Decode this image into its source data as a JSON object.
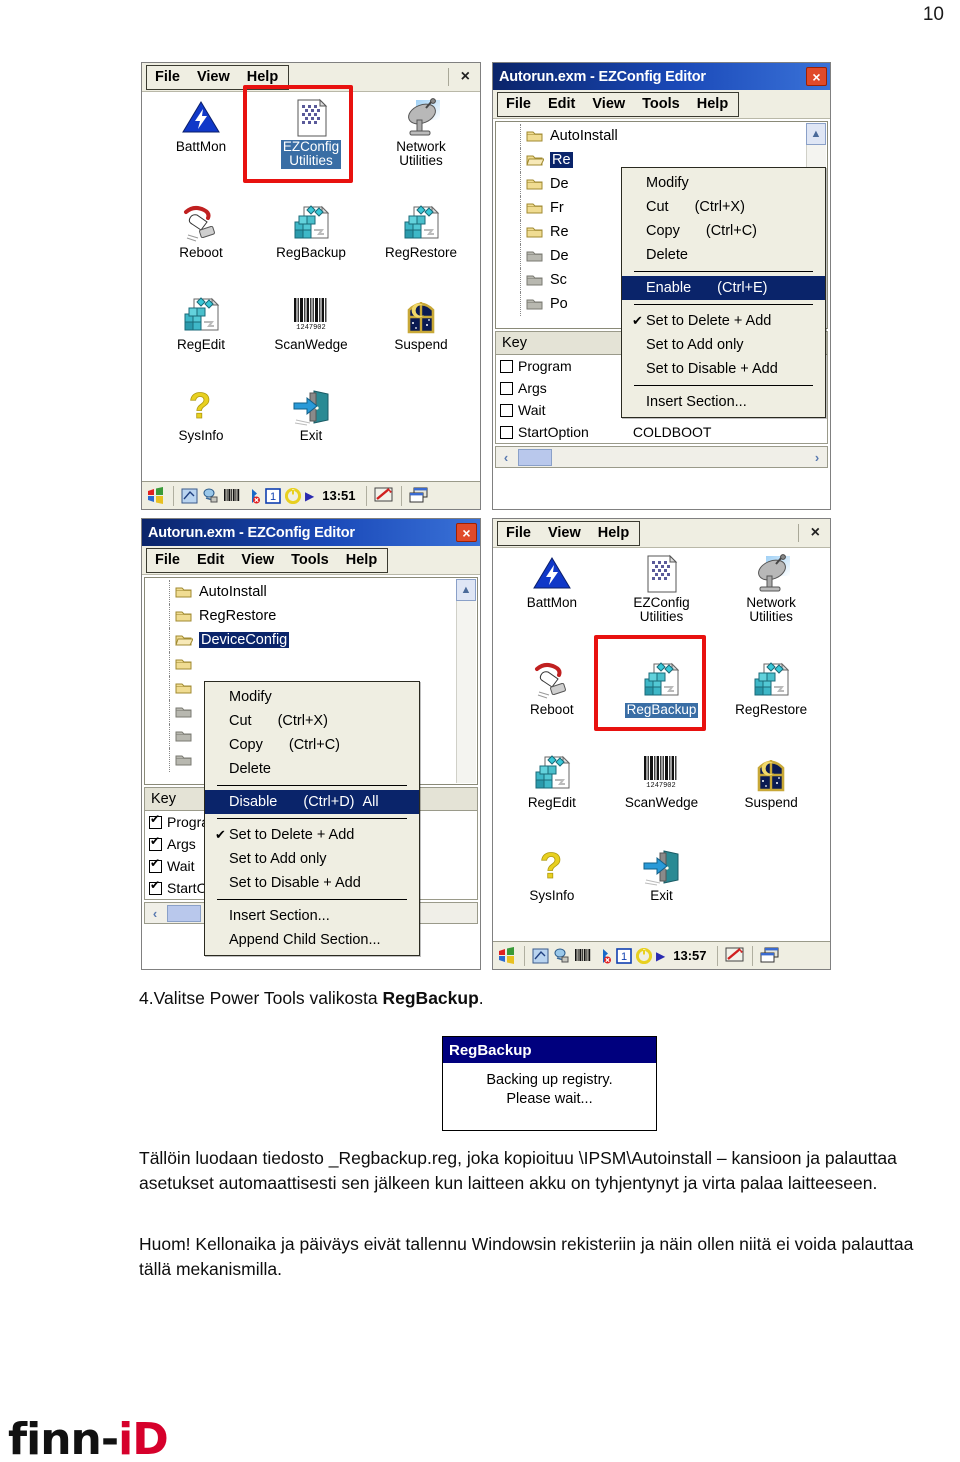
{
  "page": {
    "number": "10"
  },
  "footer": {
    "logo_black": "finn-",
    "logo_red": "iD"
  },
  "panel_top_left": {
    "menu": {
      "file": "File",
      "view": "View",
      "help": "Help",
      "close_icon": "×"
    },
    "icons": [
      {
        "name": "BattMon",
        "label": "BattMon",
        "icon": "battery-monitor-icon",
        "selected": false
      },
      {
        "name": "EZConfig",
        "label": "EZConfig\nUtilities",
        "icon": "ezconfig-utilities-icon",
        "selected": true
      },
      {
        "name": "Network",
        "label": "Network\nUtilities",
        "icon": "network-utilities-icon",
        "selected": false
      },
      {
        "name": "Reboot",
        "label": "Reboot",
        "icon": "reboot-icon",
        "selected": false
      },
      {
        "name": "RegBackup",
        "label": "RegBackup",
        "icon": "registry-backup-icon",
        "selected": false
      },
      {
        "name": "RegRestore",
        "label": "RegRestore",
        "icon": "registry-restore-icon",
        "selected": false
      },
      {
        "name": "RegEdit",
        "label": "RegEdit",
        "icon": "registry-edit-icon",
        "selected": false
      },
      {
        "name": "ScanWedge",
        "label": "ScanWedge",
        "icon": "barcode-scanwedge-icon",
        "selected": false
      },
      {
        "name": "Suspend",
        "label": "Suspend",
        "icon": "suspend-moon-icon",
        "selected": false
      },
      {
        "name": "SysInfo",
        "label": "SysInfo",
        "icon": "system-info-question-icon",
        "selected": false
      },
      {
        "name": "Exit",
        "label": "Exit",
        "icon": "exit-door-icon",
        "selected": false
      }
    ],
    "taskbar": {
      "time": "13:51"
    }
  },
  "panel_top_right": {
    "title": "Autorun.exm - EZConfig Editor",
    "close_icon": "×",
    "menu": [
      "File",
      "Edit",
      "View",
      "Tools",
      "Help"
    ],
    "tree": [
      {
        "label": "AutoInstall",
        "selected": false,
        "open": false,
        "grey": false
      },
      {
        "label": "Re",
        "selected": true,
        "open": true,
        "grey": false
      },
      {
        "label": "De",
        "selected": false,
        "open": false,
        "grey": false
      },
      {
        "label": "Fr",
        "selected": false,
        "open": false,
        "grey": false
      },
      {
        "label": "Re",
        "selected": false,
        "open": false,
        "grey": false
      },
      {
        "label": "De",
        "selected": false,
        "open": false,
        "grey": true
      },
      {
        "label": "Sc",
        "selected": false,
        "open": false,
        "grey": true
      },
      {
        "label": "Po",
        "selected": false,
        "open": false,
        "grey": true
      }
    ],
    "key_header": "Key",
    "keys": [
      {
        "label": "Program",
        "checked": false,
        "value": ""
      },
      {
        "label": "Args",
        "checked": false,
        "value": ""
      },
      {
        "label": "Wait",
        "checked": false,
        "value": ""
      },
      {
        "label": "StartOption",
        "checked": false,
        "value": "COLDBOOT"
      }
    ],
    "context_menu": [
      {
        "label": "Modify",
        "accel": "",
        "check": false,
        "highlight": false,
        "sep_after": false
      },
      {
        "label": "Cut",
        "accel": "(Ctrl+X)",
        "check": false,
        "highlight": false,
        "sep_after": false
      },
      {
        "label": "Copy",
        "accel": "(Ctrl+C)",
        "check": false,
        "highlight": false,
        "sep_after": false
      },
      {
        "label": "Delete",
        "accel": "",
        "check": false,
        "highlight": false,
        "sep_after": true
      },
      {
        "label": "Enable",
        "accel": "(Ctrl+E)",
        "check": false,
        "highlight": true,
        "sep_after": true
      },
      {
        "label": "Set to Delete + Add",
        "accel": "",
        "check": true,
        "highlight": false,
        "sep_after": false
      },
      {
        "label": "Set to Add only",
        "accel": "",
        "check": false,
        "highlight": false,
        "sep_after": false
      },
      {
        "label": "Set to Disable + Add",
        "accel": "",
        "check": false,
        "highlight": false,
        "sep_after": true
      },
      {
        "label": "Insert Section...",
        "accel": "",
        "check": false,
        "highlight": false,
        "sep_after": false
      }
    ],
    "scroll_up_icon": "▲",
    "hscroll_left_icon": "‹",
    "hscroll_right_icon": "›"
  },
  "panel_bottom_left": {
    "title": "Autorun.exm - EZConfig Editor",
    "close_icon": "×",
    "menu": [
      "File",
      "Edit",
      "View",
      "Tools",
      "Help"
    ],
    "tree": [
      {
        "label": "AutoInstall",
        "selected": false,
        "open": false,
        "grey": false
      },
      {
        "label": "RegRestore",
        "selected": false,
        "open": false,
        "grey": false
      },
      {
        "label": "DeviceConfig",
        "selected": true,
        "open": true,
        "grey": false
      },
      {
        "label": "",
        "selected": false,
        "open": false,
        "grey": false
      },
      {
        "label": "",
        "selected": false,
        "open": false,
        "grey": false
      },
      {
        "label": "",
        "selected": false,
        "open": false,
        "grey": true
      },
      {
        "label": "",
        "selected": false,
        "open": false,
        "grey": true
      },
      {
        "label": "",
        "selected": false,
        "open": false,
        "grey": true
      }
    ],
    "key_header": "Key",
    "keys": [
      {
        "label": "Program",
        "checked": true
      },
      {
        "label": "Args",
        "checked": true
      },
      {
        "label": "Wait",
        "checked": true
      },
      {
        "label": "StartOptio",
        "checked": true
      }
    ],
    "context_menu": [
      {
        "label": "Modify",
        "accel": "",
        "check": false,
        "highlight": false,
        "sep_after": false
      },
      {
        "label": "Cut",
        "accel": "(Ctrl+X)",
        "check": false,
        "highlight": false,
        "sep_after": false
      },
      {
        "label": "Copy",
        "accel": "(Ctrl+C)",
        "check": false,
        "highlight": false,
        "sep_after": false
      },
      {
        "label": "Delete",
        "accel": "",
        "check": false,
        "highlight": false,
        "sep_after": true
      },
      {
        "label": "Disable",
        "accel": "(Ctrl+D)",
        "tail": "All",
        "check": false,
        "highlight": true,
        "sep_after": true
      },
      {
        "label": "Set to Delete + Add",
        "accel": "",
        "check": true,
        "highlight": false,
        "sep_after": false
      },
      {
        "label": "Set to Add only",
        "accel": "",
        "check": false,
        "highlight": false,
        "sep_after": false
      },
      {
        "label": "Set to Disable + Add",
        "accel": "",
        "check": false,
        "highlight": false,
        "sep_after": true
      },
      {
        "label": "Insert Section...",
        "accel": "",
        "check": false,
        "highlight": false,
        "sep_after": false
      },
      {
        "label": "Append Child Section...",
        "accel": "",
        "check": false,
        "highlight": false,
        "sep_after": false
      }
    ],
    "scroll_up_icon": "▲",
    "hscroll_left_icon": "‹"
  },
  "panel_bottom_right": {
    "menu": {
      "file": "File",
      "view": "View",
      "help": "Help",
      "close_icon": "×"
    },
    "icons": [
      {
        "name": "BattMon",
        "label": "BattMon",
        "icon": "battery-monitor-icon",
        "selected": false
      },
      {
        "name": "EZConfig",
        "label": "EZConfig\nUtilities",
        "icon": "ezconfig-utilities-icon",
        "selected": false
      },
      {
        "name": "Network",
        "label": "Network\nUtilities",
        "icon": "network-utilities-icon",
        "selected": false
      },
      {
        "name": "Reboot",
        "label": "Reboot",
        "icon": "reboot-icon",
        "selected": false
      },
      {
        "name": "RegBackup",
        "label": "RegBackup",
        "icon": "registry-backup-icon",
        "selected": true
      },
      {
        "name": "RegRestore",
        "label": "RegRestore",
        "icon": "registry-restore-icon",
        "selected": false
      },
      {
        "name": "RegEdit",
        "label": "RegEdit",
        "icon": "registry-edit-icon",
        "selected": false
      },
      {
        "name": "ScanWedge",
        "label": "ScanWedge",
        "icon": "barcode-scanwedge-icon",
        "selected": false
      },
      {
        "name": "Suspend",
        "label": "Suspend",
        "icon": "suspend-moon-icon",
        "selected": false
      },
      {
        "name": "SysInfo",
        "label": "SysInfo",
        "icon": "system-info-question-icon",
        "selected": false
      },
      {
        "name": "Exit",
        "label": "Exit",
        "icon": "exit-door-icon",
        "selected": false
      }
    ],
    "taskbar": {
      "time": "13:57"
    }
  },
  "body": {
    "step4_prefix": "4.Valitse Power Tools valikosta ",
    "step4_bold": "RegBackup",
    "step4_suffix": ".",
    "dialog": {
      "title": "RegBackup",
      "line1": "Backing up registry.",
      "line2": "Please wait..."
    },
    "paragraph1": "Tällöin luodaan tiedosto _Regbackup.reg, joka kopioituu \\IPSM\\Autoinstall – kansioon ja palauttaa asetukset automaattisesti sen jälkeen kun laitteen akku on tyhjentynyt ja virta palaa laitteeseen.",
    "paragraph2": "Huom! Kellonaika ja päiväys eivät tallennu Windowsin rekisteriin ja näin ollen niitä ei voida palauttaa tällä mekanismilla."
  }
}
